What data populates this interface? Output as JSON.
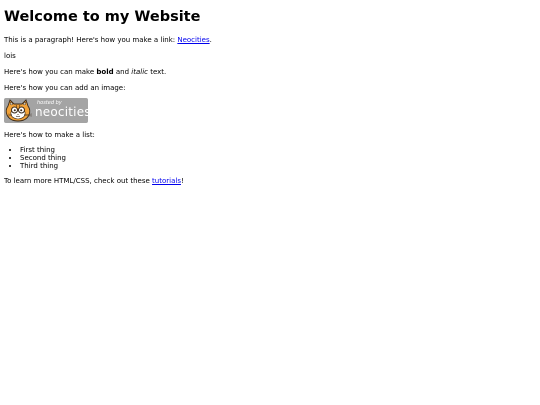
{
  "page": {
    "heading": "Welcome to my Website",
    "intro": {
      "prefix": "This is a paragraph! Here's how you make a link: ",
      "link_text": "Neocities",
      "suffix": "."
    },
    "name_line": "lois",
    "styles_line": {
      "prefix": "Here's how you can make ",
      "bold": "bold",
      "middle": " and ",
      "italic": "italic",
      "suffix": " text."
    },
    "image_line": "Here's how you can add an image:",
    "badge": {
      "small_text": "hosted by",
      "brand_text": "neocities",
      "icon": "neocities-cat-logo-icon"
    },
    "list_intro": "Here's how to make a list:",
    "list_items": [
      "First thing",
      "Second thing",
      "Third thing"
    ],
    "outro": {
      "prefix": "To learn more HTML/CSS, check out these ",
      "link_text": "tutorials",
      "suffix": "!"
    }
  },
  "colors": {
    "link": "#0000ee",
    "badge_bg": "#a4a4a4",
    "text": "#000000"
  }
}
